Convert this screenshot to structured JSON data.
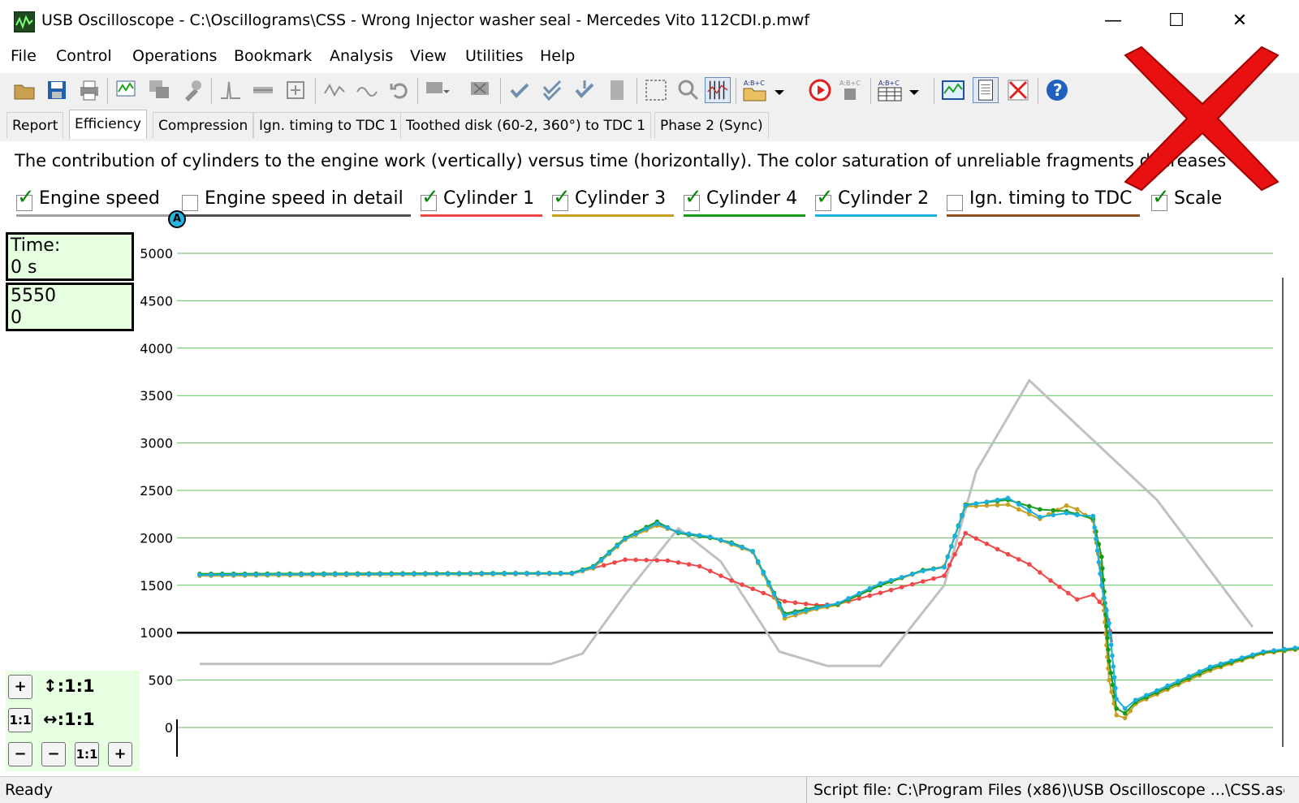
{
  "window": {
    "title": "USB Oscilloscope - C:\\Oscillograms\\CSS - Wrong Injector washer seal - Mercedes Vito 112CDI.p.mwf",
    "minimize": "—",
    "maximize": "☐",
    "close": "✕"
  },
  "menu": [
    "File",
    "Control",
    "Operations",
    "Bookmark",
    "Analysis",
    "View",
    "Utilities",
    "Help"
  ],
  "tabs": [
    "Report",
    "Efficiency",
    "Compression",
    "Ign. timing to TDC 1",
    "Toothed disk (60-2, 360°) to TDC 1",
    "Phase 2 (Sync)"
  ],
  "active_tab": "Efficiency",
  "description": "The contribution of cylinders to the engine work (vertically) versus time (horizontally). The color saturation of unreliable fragments decreases",
  "legend": [
    {
      "label": "Engine speed",
      "checked": true,
      "color": "#a0a0a0"
    },
    {
      "label": "Engine speed in detail",
      "checked": false,
      "color": "#505050"
    },
    {
      "label": "Cylinder 1",
      "checked": true,
      "color": "#f04848"
    },
    {
      "label": "Cylinder 3",
      "checked": true,
      "color": "#c8a020"
    },
    {
      "label": "Cylinder 4",
      "checked": true,
      "color": "#1a9a1a"
    },
    {
      "label": "Cylinder 2",
      "checked": true,
      "color": "#18b0e0"
    },
    {
      "label": "Ign. timing to TDC",
      "checked": false,
      "color": "#8a5020"
    },
    {
      "label": "Scale",
      "checked": true,
      "color": "#ffffff"
    }
  ],
  "marker_label": "A",
  "info": {
    "time_label": "Time:",
    "time_value": "0 s",
    "value1": "5550",
    "value2": "0"
  },
  "zoom": {
    "plus": "+",
    "v_ratio": "↕:1:1",
    "one_to_one": "1:1",
    "h_ratio": "↔:1:1",
    "minus": "−"
  },
  "status": {
    "left": "Ready",
    "right": "Script file: C:\\Program Files (x86)\\USB Oscilloscope ...\\CSS.asc"
  },
  "chart_data": {
    "type": "line",
    "ylim": [
      0,
      5000
    ],
    "yticks": [
      0,
      500,
      1000,
      1500,
      2000,
      2500,
      3000,
      3500,
      4000,
      4500,
      5000
    ],
    "reference_line": 1000,
    "grid": true,
    "xlim": [
      0,
      1000
    ],
    "series": [
      {
        "name": "Engine speed",
        "color": "#c0c0c0",
        "x": [
          0,
          120,
          260,
          330,
          360,
          400,
          450,
          490,
          545,
          590,
          640,
          700,
          730,
          780,
          900,
          990
        ],
        "y": [
          670,
          670,
          670,
          670,
          780,
          1400,
          2100,
          1750,
          800,
          650,
          650,
          1500,
          2700,
          3660,
          2400,
          1060
        ]
      },
      {
        "name": "Cylinder 1",
        "color": "#f04848",
        "x": [
          0,
          350,
          370,
          400,
          440,
          470,
          500,
          550,
          580,
          600,
          700,
          720,
          750,
          780,
          800,
          825,
          840,
          852,
          858
        ],
        "y": [
          1610,
          1620,
          1680,
          1770,
          1760,
          1700,
          1550,
          1330,
          1290,
          1300,
          1600,
          2050,
          1880,
          1720,
          1550,
          1350,
          1400,
          1250,
          900
        ]
      },
      {
        "name": "Cylinder 3",
        "color": "#c8a020",
        "x": [
          0,
          350,
          370,
          400,
          430,
          450,
          480,
          500,
          520,
          550,
          580,
          600,
          640,
          680,
          700,
          720,
          760,
          790,
          815,
          825,
          840,
          848,
          855,
          862,
          870,
          880,
          950,
          1000,
          1060
        ],
        "y": [
          1600,
          1620,
          1680,
          1980,
          2130,
          2060,
          2010,
          1930,
          1850,
          1150,
          1250,
          1290,
          1500,
          1650,
          1700,
          2330,
          2350,
          2200,
          2340,
          2300,
          2180,
          1600,
          500,
          130,
          100,
          250,
          600,
          780,
          860
        ]
      },
      {
        "name": "Cylinder 4",
        "color": "#1a9a1a",
        "x": [
          0,
          350,
          370,
          400,
          430,
          450,
          480,
          500,
          520,
          550,
          580,
          600,
          640,
          680,
          700,
          720,
          760,
          790,
          815,
          825,
          840,
          848,
          855,
          862,
          870,
          880,
          950,
          1000,
          1060
        ],
        "y": [
          1620,
          1630,
          1700,
          2000,
          2170,
          2050,
          2000,
          1950,
          1860,
          1200,
          1270,
          1300,
          1500,
          1660,
          1690,
          2350,
          2400,
          2300,
          2280,
          2250,
          2200,
          1800,
          700,
          200,
          150,
          270,
          620,
          790,
          870
        ]
      },
      {
        "name": "Cylinder 2",
        "color": "#18b0e0",
        "x": [
          0,
          350,
          370,
          400,
          430,
          450,
          480,
          500,
          520,
          550,
          580,
          600,
          640,
          680,
          700,
          720,
          760,
          790,
          815,
          825,
          840,
          848,
          855,
          862,
          870,
          880,
          950,
          1000,
          1060
        ],
        "y": [
          1610,
          1625,
          1690,
          1990,
          2150,
          2060,
          2010,
          1940,
          1860,
          1180,
          1260,
          1310,
          1520,
          1650,
          1690,
          2340,
          2420,
          2220,
          2260,
          2240,
          2230,
          1500,
          1100,
          300,
          200,
          290,
          640,
          800,
          880
        ]
      }
    ]
  }
}
